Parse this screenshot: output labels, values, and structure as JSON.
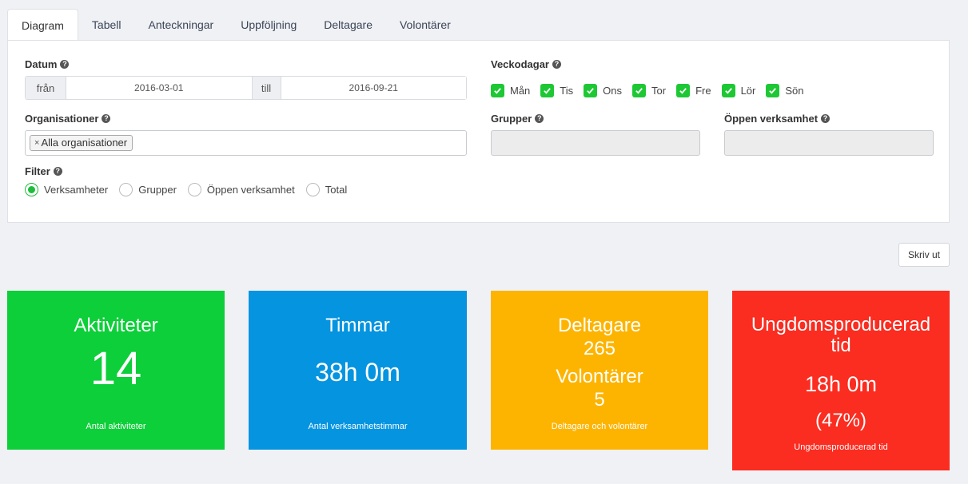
{
  "tabs": [
    "Diagram",
    "Tabell",
    "Anteckningar",
    "Uppföljning",
    "Deltagare",
    "Volontärer"
  ],
  "filters": {
    "date": {
      "label": "Datum",
      "from_label": "från",
      "from_value": "2016-03-01",
      "to_label": "till",
      "to_value": "2016-09-21"
    },
    "weekdays": {
      "label": "Veckodagar",
      "days": [
        "Mån",
        "Tis",
        "Ons",
        "Tor",
        "Fre",
        "Lör",
        "Sön"
      ]
    },
    "organisations": {
      "label": "Organisationer",
      "token": "Alla organisationer",
      "token_remove": "×"
    },
    "groups": {
      "label": "Grupper"
    },
    "open_activity": {
      "label": "Öppen verksamhet"
    },
    "filter": {
      "label": "Filter",
      "options": [
        "Verksamheter",
        "Grupper",
        "Öppen verksamhet",
        "Total"
      ],
      "selected": "Verksamheter"
    }
  },
  "print_button": "Skriv ut",
  "cards": {
    "activities": {
      "title": "Aktiviteter",
      "value": "14",
      "footer": "Antal aktiviteter",
      "color": "#0ccf39"
    },
    "hours": {
      "title": "Timmar",
      "value": "38h 0m",
      "footer": "Antal verksamhetstimmar",
      "color": "#0494e0"
    },
    "participants": {
      "title": "Deltagare",
      "value": "265",
      "title2": "Volontärer",
      "value2": "5",
      "footer": "Deltagare och volontärer",
      "color": "#fdb400"
    },
    "youth": {
      "title_line1": "Ungdomsproducerad",
      "title_line2": "tid",
      "value": "18h 0m",
      "percent": "(47%)",
      "footer": "Ungdomsproducerad tid",
      "color": "#fb2c20"
    }
  }
}
